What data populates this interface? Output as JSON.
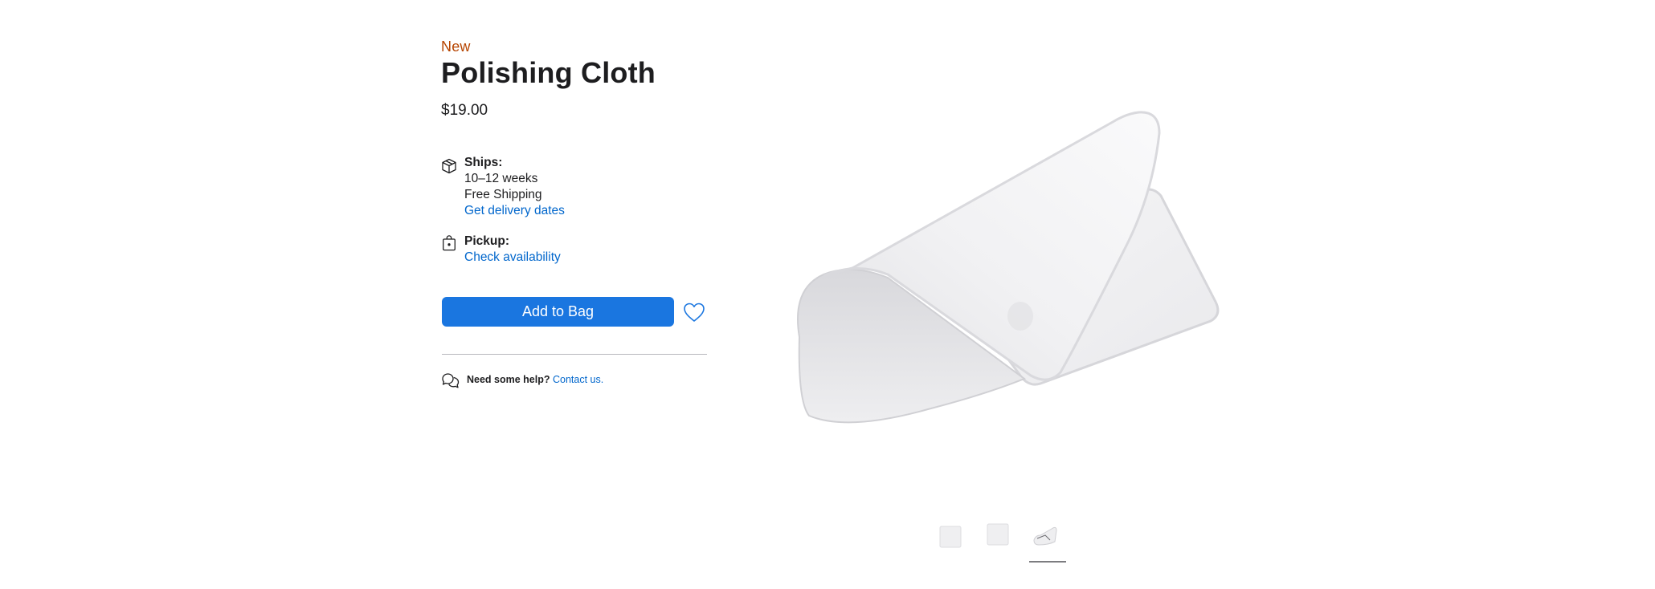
{
  "product": {
    "badge": "New",
    "title": "Polishing Cloth",
    "price": "$19.00"
  },
  "shipping": {
    "icon": "box-icon",
    "label": "Ships:",
    "eta": "10–12 weeks",
    "cost": "Free Shipping",
    "link": "Get delivery dates"
  },
  "pickup": {
    "icon": "store-bag-icon",
    "label": "Pickup:",
    "link": "Check availability"
  },
  "actions": {
    "add_to_bag": "Add to Bag",
    "favorite_icon": "heart-icon"
  },
  "help": {
    "icon": "chat-bubbles-icon",
    "question": "Need some help?",
    "link": "Contact us."
  },
  "gallery": {
    "thumbnail_count": 3,
    "selected_index": 2
  },
  "colors": {
    "accent": "#0066cc",
    "button": "#1a76e0",
    "badge": "#b64400",
    "text": "#1d1d1f"
  }
}
